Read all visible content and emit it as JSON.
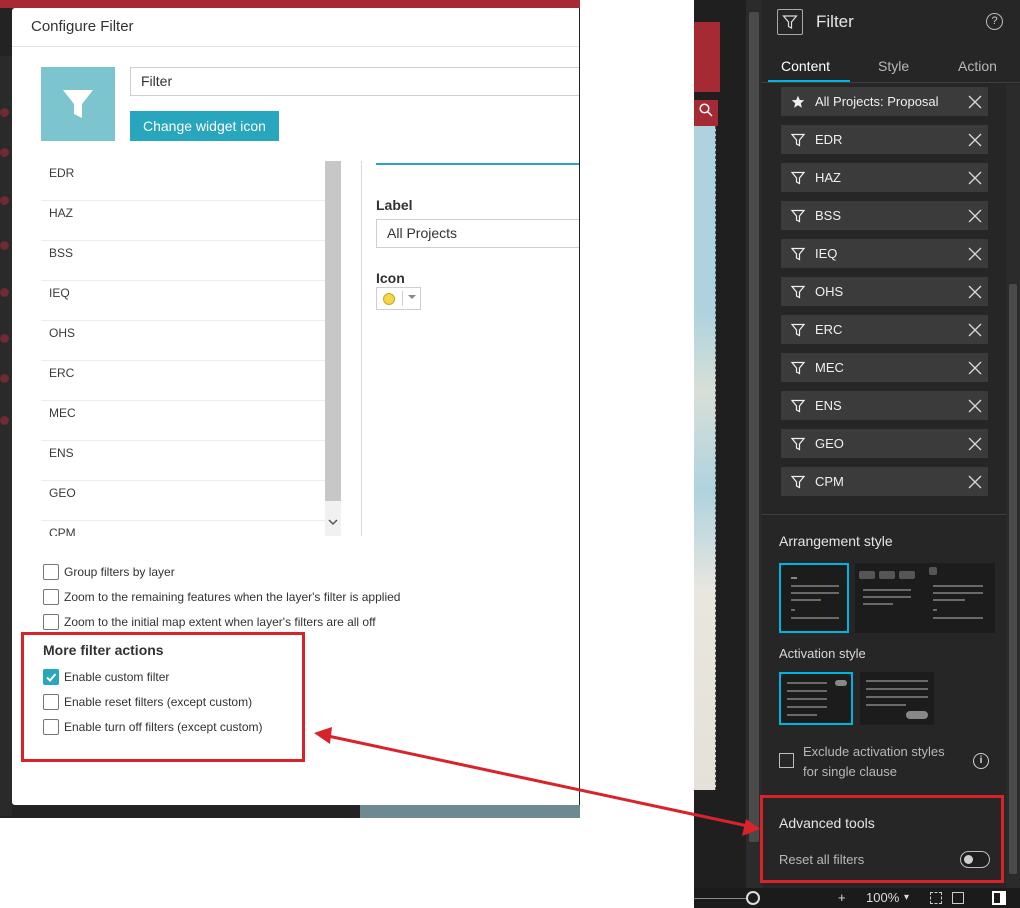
{
  "modal": {
    "title": "Configure Filter",
    "widget_name": "Filter",
    "change_icon_label": "Change widget icon",
    "filters": [
      "EDR",
      "HAZ",
      "BSS",
      "IEQ",
      "OHS",
      "ERC",
      "MEC",
      "ENS",
      "GEO",
      "CPM"
    ],
    "detail": {
      "label_caption": "Label",
      "label_value": "All Projects",
      "icon_caption": "Icon",
      "icon_color": "#f5d64b"
    },
    "options": [
      {
        "label": "Group filters by layer",
        "checked": false
      },
      {
        "label": "Zoom to the remaining features when the layer's filter is applied",
        "checked": false
      },
      {
        "label": "Zoom to the initial map extent when layer's filters are all off",
        "checked": false
      }
    ],
    "more_actions": {
      "title": "More filter actions",
      "items": [
        {
          "label": "Enable custom filter",
          "checked": true
        },
        {
          "label": "Enable reset filters (except custom)",
          "checked": false
        },
        {
          "label": "Enable turn off filters (except custom)",
          "checked": false
        }
      ]
    }
  },
  "panel": {
    "title": "Filter",
    "help": "?",
    "tabs": [
      "Content",
      "Style",
      "Action"
    ],
    "chips": [
      {
        "label": "All Projects: Proposal",
        "icon": "star-icon"
      },
      {
        "label": "EDR",
        "icon": "filter-icon"
      },
      {
        "label": "HAZ",
        "icon": "filter-icon"
      },
      {
        "label": "BSS",
        "icon": "filter-icon"
      },
      {
        "label": "IEQ",
        "icon": "filter-icon"
      },
      {
        "label": "OHS",
        "icon": "filter-icon"
      },
      {
        "label": "ERC",
        "icon": "filter-icon"
      },
      {
        "label": "MEC",
        "icon": "filter-icon"
      },
      {
        "label": "ENS",
        "icon": "filter-icon"
      },
      {
        "label": "GEO",
        "icon": "filter-icon"
      },
      {
        "label": "CPM",
        "icon": "filter-icon"
      }
    ],
    "arrangement_title": "Arrangement style",
    "activation_title": "Activation style",
    "exclude_label": "Exclude activation styles for single clause",
    "info": "i",
    "advanced_title": "Advanced tools",
    "reset_all_label": "Reset all filters",
    "reset_all_on": false
  },
  "statusbar": {
    "plus": "+",
    "zoom": "100%",
    "zoom_caret": "▾"
  },
  "colors": {
    "accent": "#27a6bd",
    "panel_accent": "#00b4dd",
    "highlight": "#d8232a",
    "widget_icon_bg": "#7cc4ce"
  }
}
